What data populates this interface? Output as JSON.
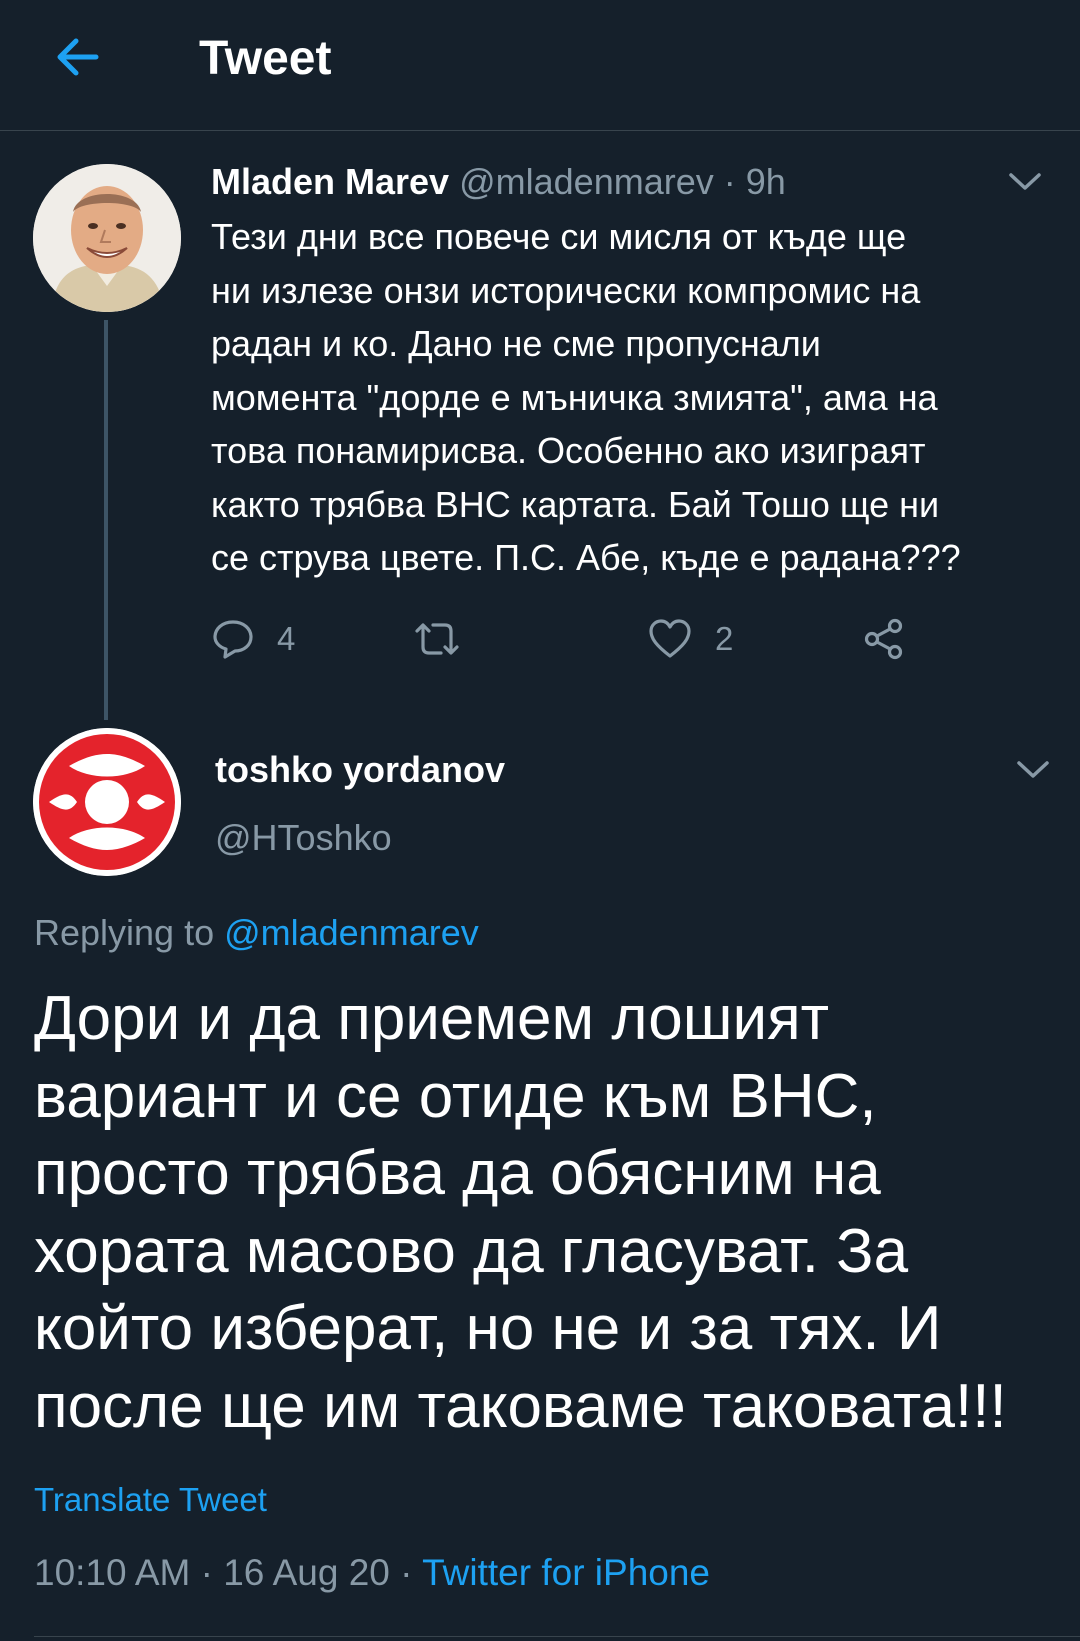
{
  "header": {
    "title": "Tweet",
    "back_icon": "arrow-left-icon"
  },
  "colors": {
    "background": "#15202b",
    "accent": "#1da1f2",
    "secondary_text": "#8899a6",
    "divider": "#38444d"
  },
  "parent_tweet": {
    "name": "Mladen Marev",
    "handle": "@mladenmarev",
    "separator": " · ",
    "time": "9h",
    "lines": [
      "Тези дни все повече си мисля от къде ще",
      "ни излезе онзи исторически компромис на",
      "радан и ко. Дано не сме пропуснали",
      "момента \"дорде е мъничка змията\", ама на",
      "това понамирисва. Особенно ако изиграят",
      "както трябва ВНС картата. Бай Тошо ще ни",
      "се струва цвете. П.С. Абе, къде е радана???"
    ],
    "actions": {
      "reply_count": "4",
      "retweet_count": "",
      "like_count": "2"
    }
  },
  "reply_tweet": {
    "name": "toshko yordanov",
    "handle": "@HToshko",
    "replying_prefix": "Replying to ",
    "replying_handle": "@mladenmarev",
    "lines": [
      "Дори и да приемем лошият",
      "вариант и се отиде към ВНС,",
      "просто трябва да обясним на",
      "хората масово да гласуват. За",
      "който изберат, но не и за тях. И",
      "после ще им таковаме таковата!!!"
    ],
    "translate_label": "Translate Tweet",
    "timestamp": "10:10 AM · 16 Aug 20 · ",
    "source": "Twitter for iPhone"
  }
}
